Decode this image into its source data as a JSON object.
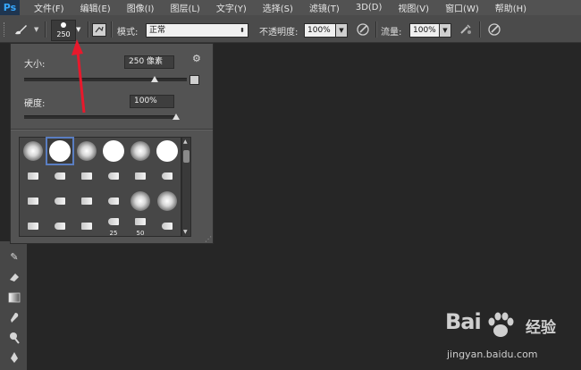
{
  "app": {
    "logo": "Ps"
  },
  "menu": [
    "文件(F)",
    "编辑(E)",
    "图像(I)",
    "图层(L)",
    "文字(Y)",
    "选择(S)",
    "滤镜(T)",
    "3D(D)",
    "视图(V)",
    "窗口(W)",
    "帮助(H)"
  ],
  "options": {
    "brush_size_value": "250",
    "mode_label": "模式:",
    "mode_value": "正常",
    "opacity_label": "不透明度:",
    "opacity_value": "100%",
    "flow_label": "流量:",
    "flow_value": "100%"
  },
  "brush_panel": {
    "size_label": "大小:",
    "size_value": "250 像素",
    "size_fraction": 0.8,
    "hardness_label": "硬度:",
    "hardness_value": "100%",
    "hardness_fraction": 1.0,
    "presets": [
      {
        "kind": "soft"
      },
      {
        "kind": "hard",
        "selected": true
      },
      {
        "kind": "soft"
      },
      {
        "kind": "hard"
      },
      {
        "kind": "soft"
      },
      {
        "kind": "hard"
      },
      {
        "kind": "mini"
      },
      {
        "kind": "mini"
      },
      {
        "kind": "mini"
      },
      {
        "kind": "mini"
      },
      {
        "kind": "mini"
      },
      {
        "kind": "mini"
      },
      {
        "kind": "mini"
      },
      {
        "kind": "mini"
      },
      {
        "kind": "mini"
      },
      {
        "kind": "mini"
      },
      {
        "kind": "soft"
      },
      {
        "kind": "soft"
      },
      {
        "kind": "mini"
      },
      {
        "kind": "mini"
      },
      {
        "kind": "mini"
      },
      {
        "kind": "mini",
        "label": "25"
      },
      {
        "kind": "mini",
        "label": "50"
      },
      {
        "kind": "mini"
      }
    ]
  },
  "colors": {
    "annotation_arrow": "#e8192c",
    "selection": "#5a7ec2"
  },
  "watermark": {
    "brand": "Bai",
    "cn": "经验",
    "url": "jingyan.baidu.com"
  }
}
